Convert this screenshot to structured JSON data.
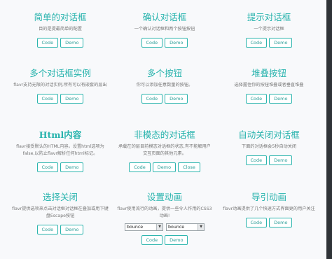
{
  "cards": [
    {
      "title": "简单的对话框",
      "desc": "目的是提最简单的配置",
      "buttons": [
        "Code",
        "Demo"
      ]
    },
    {
      "title": "确认对话框",
      "desc": "一个确认对话框和两个按钮按钮",
      "buttons": [
        "Code",
        "Demo"
      ]
    },
    {
      "title": "提示对话框",
      "desc": "一个提示对话框",
      "buttons": [
        "Code",
        "Demo"
      ]
    },
    {
      "title": "多个对话框实例",
      "desc": "flavr支持无限的对话实例,所有可以有嵌套的层出",
      "buttons": [
        "Code",
        "Demo"
      ]
    },
    {
      "title": "多个按钮",
      "desc": "你可以添加任意数量的按钮。",
      "buttons": [
        "Code",
        "Demo"
      ]
    },
    {
      "title": "堆叠按钮",
      "desc": "选择握住你的按钮堆叠或者垂直堆叠",
      "buttons": [
        "Code",
        "Demo"
      ]
    },
    {
      "title": "Html内容",
      "desc": "flavr接受默认的HTML内容。设置html选项为false,以防止flavr解析任何html标记。",
      "buttons": [
        "Code",
        "Demo"
      ]
    },
    {
      "title": "非模态的对话框",
      "desc": "承载在的层目前模态对话框的状态,有不能解用户交互页面的其他元素。",
      "buttons": [
        "Code",
        "Demo",
        "Close"
      ]
    },
    {
      "title": "自动关闭对话框",
      "desc": "下面的对话框会5秒自动关闭",
      "buttons": [
        "Code",
        "Demo"
      ]
    },
    {
      "title": "选择关闭",
      "desc": "flavr提供选项来点击对话框对话框在叠加或用下键盘Escape按钮",
      "buttons": [
        "Code",
        "Demo"
      ]
    },
    {
      "title": "设置动画",
      "desc": "flavr使用流行的动画，提供一些令人作用的CSS3动画!",
      "selects": [
        "bounce",
        "bounce"
      ],
      "buttons": [
        "Code",
        "Demo"
      ]
    },
    {
      "title": "导引动画",
      "desc": "flavr动画提供了几个快速方式界面更的用户关注",
      "buttons": [
        "Code",
        "Demo"
      ]
    }
  ]
}
